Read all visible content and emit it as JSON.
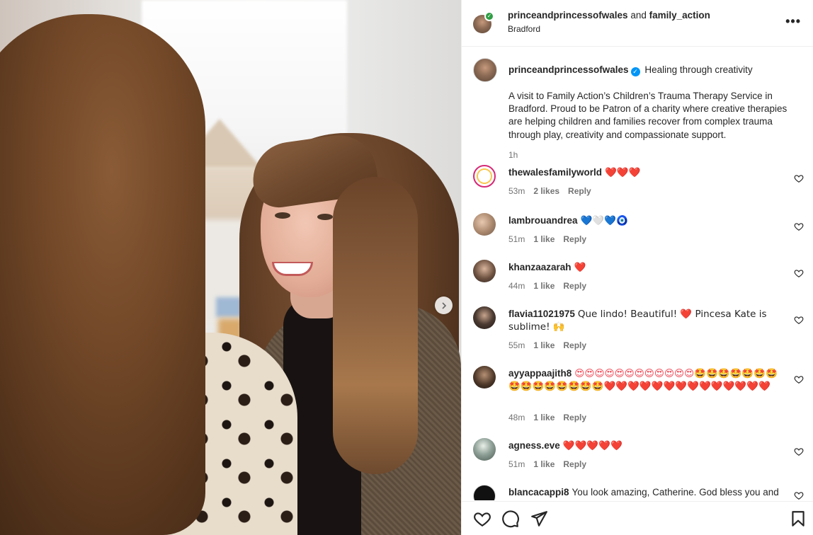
{
  "header": {
    "user1": "princeandprincessofwales",
    "joiner": "and",
    "user2": "family_action",
    "location": "Bradford",
    "more_label": "•••"
  },
  "caption": {
    "user": "princeandprincessofwales",
    "title": "Healing through creativity",
    "body": "A visit to Family Action’s Children’s Trauma Therapy Service in Bradford. Proud to be Patron of a charity where creative therapies are helping children and families recover from complex trauma through play, creativity and compassionate support.",
    "time": "1h"
  },
  "comments": [
    {
      "user": "thewalesfamilyworld",
      "text": "❤️❤️❤️",
      "time": "53m",
      "likes": "2 likes",
      "reply": "Reply"
    },
    {
      "user": "lambrouandrea",
      "text": "💙🤍💙🧿",
      "time": "51m",
      "likes": "1 like",
      "reply": "Reply"
    },
    {
      "user": "khanzaazarah",
      "text": "❤️",
      "time": "44m",
      "likes": "1 like",
      "reply": "Reply"
    },
    {
      "user": "flavia11021975",
      "text": "Que lindo! Beautiful! ❤️ Pincesa Kate is sublime! 🙌",
      "time": "55m",
      "likes": "1 like",
      "reply": "Reply"
    },
    {
      "user": "ayyappaajith8",
      "text": "😍😍😍😍😍😍😍😍😍😍😍😍🤩🤩🤩🤩🤩🤩🤩🤩🤩🤩🤩🤩🤩🤩🤩❤️❤️❤️❤️❤️❤️❤️❤️❤️❤️❤️❤️❤️❤️",
      "time": "48m",
      "likes": "1 like",
      "reply": "Reply"
    },
    {
      "user": "agness.eve",
      "text": "❤️❤️❤️❤️❤️",
      "time": "51m",
      "likes": "1 like",
      "reply": "Reply"
    },
    {
      "user": "blancacappi8",
      "text": "You look amazing, Catherine. God bless you and",
      "time": "",
      "likes": "",
      "reply": ""
    }
  ],
  "colors": {
    "accent": "#0095f6",
    "heart": "#ed4956",
    "muted": "#737373"
  }
}
